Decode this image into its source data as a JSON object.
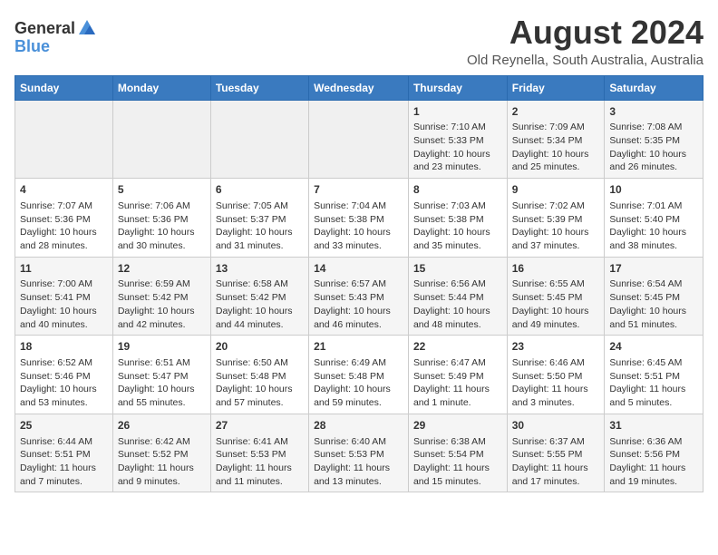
{
  "header": {
    "logo_general": "General",
    "logo_blue": "Blue",
    "title": "August 2024",
    "subtitle": "Old Reynella, South Australia, Australia"
  },
  "calendar": {
    "days_of_week": [
      "Sunday",
      "Monday",
      "Tuesday",
      "Wednesday",
      "Thursday",
      "Friday",
      "Saturday"
    ],
    "weeks": [
      [
        {
          "day": "",
          "content": ""
        },
        {
          "day": "",
          "content": ""
        },
        {
          "day": "",
          "content": ""
        },
        {
          "day": "",
          "content": ""
        },
        {
          "day": "1",
          "content": "Sunrise: 7:10 AM\nSunset: 5:33 PM\nDaylight: 10 hours\nand 23 minutes."
        },
        {
          "day": "2",
          "content": "Sunrise: 7:09 AM\nSunset: 5:34 PM\nDaylight: 10 hours\nand 25 minutes."
        },
        {
          "day": "3",
          "content": "Sunrise: 7:08 AM\nSunset: 5:35 PM\nDaylight: 10 hours\nand 26 minutes."
        }
      ],
      [
        {
          "day": "4",
          "content": "Sunrise: 7:07 AM\nSunset: 5:36 PM\nDaylight: 10 hours\nand 28 minutes."
        },
        {
          "day": "5",
          "content": "Sunrise: 7:06 AM\nSunset: 5:36 PM\nDaylight: 10 hours\nand 30 minutes."
        },
        {
          "day": "6",
          "content": "Sunrise: 7:05 AM\nSunset: 5:37 PM\nDaylight: 10 hours\nand 31 minutes."
        },
        {
          "day": "7",
          "content": "Sunrise: 7:04 AM\nSunset: 5:38 PM\nDaylight: 10 hours\nand 33 minutes."
        },
        {
          "day": "8",
          "content": "Sunrise: 7:03 AM\nSunset: 5:38 PM\nDaylight: 10 hours\nand 35 minutes."
        },
        {
          "day": "9",
          "content": "Sunrise: 7:02 AM\nSunset: 5:39 PM\nDaylight: 10 hours\nand 37 minutes."
        },
        {
          "day": "10",
          "content": "Sunrise: 7:01 AM\nSunset: 5:40 PM\nDaylight: 10 hours\nand 38 minutes."
        }
      ],
      [
        {
          "day": "11",
          "content": "Sunrise: 7:00 AM\nSunset: 5:41 PM\nDaylight: 10 hours\nand 40 minutes."
        },
        {
          "day": "12",
          "content": "Sunrise: 6:59 AM\nSunset: 5:42 PM\nDaylight: 10 hours\nand 42 minutes."
        },
        {
          "day": "13",
          "content": "Sunrise: 6:58 AM\nSunset: 5:42 PM\nDaylight: 10 hours\nand 44 minutes."
        },
        {
          "day": "14",
          "content": "Sunrise: 6:57 AM\nSunset: 5:43 PM\nDaylight: 10 hours\nand 46 minutes."
        },
        {
          "day": "15",
          "content": "Sunrise: 6:56 AM\nSunset: 5:44 PM\nDaylight: 10 hours\nand 48 minutes."
        },
        {
          "day": "16",
          "content": "Sunrise: 6:55 AM\nSunset: 5:45 PM\nDaylight: 10 hours\nand 49 minutes."
        },
        {
          "day": "17",
          "content": "Sunrise: 6:54 AM\nSunset: 5:45 PM\nDaylight: 10 hours\nand 51 minutes."
        }
      ],
      [
        {
          "day": "18",
          "content": "Sunrise: 6:52 AM\nSunset: 5:46 PM\nDaylight: 10 hours\nand 53 minutes."
        },
        {
          "day": "19",
          "content": "Sunrise: 6:51 AM\nSunset: 5:47 PM\nDaylight: 10 hours\nand 55 minutes."
        },
        {
          "day": "20",
          "content": "Sunrise: 6:50 AM\nSunset: 5:48 PM\nDaylight: 10 hours\nand 57 minutes."
        },
        {
          "day": "21",
          "content": "Sunrise: 6:49 AM\nSunset: 5:48 PM\nDaylight: 10 hours\nand 59 minutes."
        },
        {
          "day": "22",
          "content": "Sunrise: 6:47 AM\nSunset: 5:49 PM\nDaylight: 11 hours\nand 1 minute."
        },
        {
          "day": "23",
          "content": "Sunrise: 6:46 AM\nSunset: 5:50 PM\nDaylight: 11 hours\nand 3 minutes."
        },
        {
          "day": "24",
          "content": "Sunrise: 6:45 AM\nSunset: 5:51 PM\nDaylight: 11 hours\nand 5 minutes."
        }
      ],
      [
        {
          "day": "25",
          "content": "Sunrise: 6:44 AM\nSunset: 5:51 PM\nDaylight: 11 hours\nand 7 minutes."
        },
        {
          "day": "26",
          "content": "Sunrise: 6:42 AM\nSunset: 5:52 PM\nDaylight: 11 hours\nand 9 minutes."
        },
        {
          "day": "27",
          "content": "Sunrise: 6:41 AM\nSunset: 5:53 PM\nDaylight: 11 hours\nand 11 minutes."
        },
        {
          "day": "28",
          "content": "Sunrise: 6:40 AM\nSunset: 5:53 PM\nDaylight: 11 hours\nand 13 minutes."
        },
        {
          "day": "29",
          "content": "Sunrise: 6:38 AM\nSunset: 5:54 PM\nDaylight: 11 hours\nand 15 minutes."
        },
        {
          "day": "30",
          "content": "Sunrise: 6:37 AM\nSunset: 5:55 PM\nDaylight: 11 hours\nand 17 minutes."
        },
        {
          "day": "31",
          "content": "Sunrise: 6:36 AM\nSunset: 5:56 PM\nDaylight: 11 hours\nand 19 minutes."
        }
      ]
    ]
  }
}
